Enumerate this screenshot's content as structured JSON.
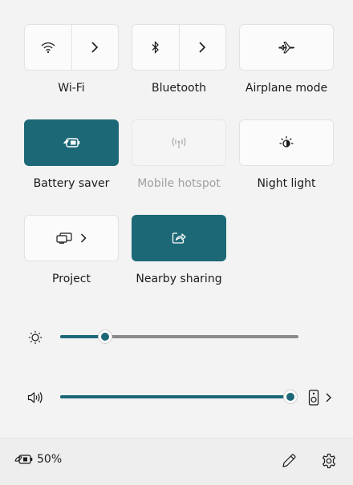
{
  "tiles": {
    "wifi": {
      "label": "Wi-Fi",
      "icon": "wifi-icon",
      "active": false
    },
    "bluetooth": {
      "label": "Bluetooth",
      "icon": "bluetooth-icon",
      "active": false
    },
    "airplane": {
      "label": "Airplane mode",
      "icon": "airplane-icon",
      "active": false
    },
    "battery_saver": {
      "label": "Battery saver",
      "icon": "battery-saver-icon",
      "active": true
    },
    "mobile_hotspot": {
      "label": "Mobile hotspot",
      "icon": "hotspot-icon",
      "active": false,
      "disabled": true
    },
    "night_light": {
      "label": "Night light",
      "icon": "night-light-icon",
      "active": false
    },
    "project": {
      "label": "Project",
      "icon": "project-icon",
      "active": false
    },
    "nearby_sharing": {
      "label": "Nearby sharing",
      "icon": "share-icon",
      "active": true
    }
  },
  "brightness": {
    "icon": "brightness-icon",
    "level": 0.19
  },
  "volume": {
    "icon": "speaker-icon",
    "level": 1.0,
    "output_icon": "audio-device-icon"
  },
  "footer": {
    "battery_icon": "battery-icon",
    "battery_percent": "50%",
    "edit_icon": "pencil-icon",
    "settings_icon": "gear-icon"
  },
  "colors": {
    "accent": "#1d6876",
    "panel": "#f3f3f3",
    "tile": "#fbfbfb"
  }
}
